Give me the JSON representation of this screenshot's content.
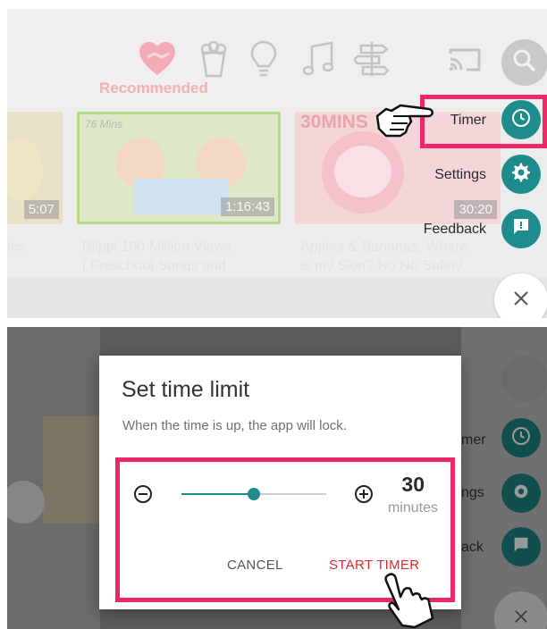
{
  "panel1": {
    "categories": [
      {
        "name": "recommended",
        "icon": "heart-icon"
      },
      {
        "name": "shows",
        "icon": "popcorn-icon"
      },
      {
        "name": "learning",
        "icon": "lightbulb-icon"
      },
      {
        "name": "music",
        "icon": "music-note-icon"
      },
      {
        "name": "explore",
        "icon": "signpost-icon"
      }
    ],
    "active_category_label": "Recommended",
    "videos": [
      {
        "duration": "5:07",
        "title_line1": "ies",
        "title_line2": ""
      },
      {
        "tag": "76 Mins",
        "duration": "1:16:43",
        "title_line1": "Blippi 100 Million Views",
        "title_line2": "| Preschool Songs and"
      },
      {
        "tag": "30MINS",
        "duration": "30:20",
        "title_line1": "Apples & Bananas, Where",
        "title_line2": "is my Skin? No No Safety"
      }
    ],
    "menu": {
      "timer_label": "Timer",
      "settings_label": "Settings",
      "feedback_label": "Feedback",
      "close_icon": "close-icon"
    },
    "colors": {
      "fab": "#1e8c8c",
      "highlight": "#ec2866"
    }
  },
  "panel2": {
    "dialog_title": "Set time limit",
    "dialog_subtitle": "When the time is up, the app will lock.",
    "minutes_value": "30",
    "minutes_unit": "minutes",
    "slider_level_fraction": 0.5,
    "cancel_label": "CANCEL",
    "start_label": "START TIMER",
    "bg_partial_labels": {
      "timer": "mer",
      "settings": "ngs",
      "feedback": "ack"
    },
    "colors": {
      "accent": "#1e8c8c",
      "start_button": "#e0292f",
      "highlight": "#ec2866"
    }
  }
}
